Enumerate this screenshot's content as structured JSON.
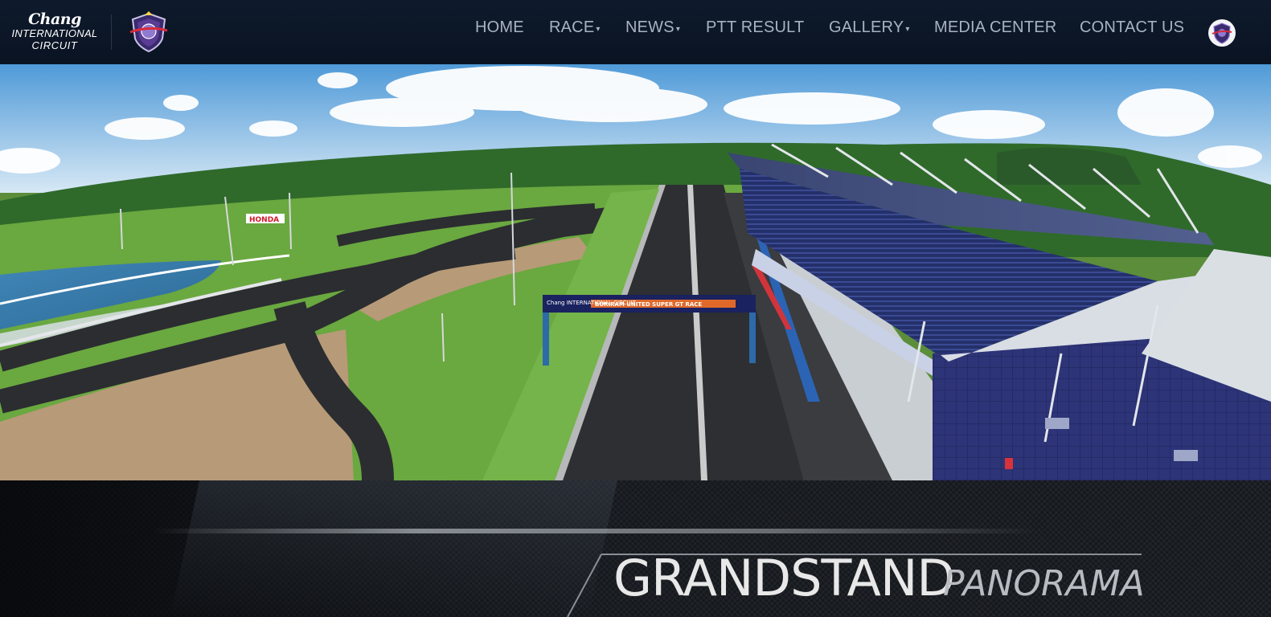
{
  "brand": {
    "line1": "Chang",
    "line2": "INTERNATIONAL",
    "line3": "CIRCUIT"
  },
  "nav": {
    "items": [
      {
        "label": "HOME",
        "dropdown": false
      },
      {
        "label": "RACE",
        "dropdown": true
      },
      {
        "label": "NEWS",
        "dropdown": true
      },
      {
        "label": "PTT RESULT",
        "dropdown": false
      },
      {
        "label": "GALLERY",
        "dropdown": true
      },
      {
        "label": "MEDIA CENTER",
        "dropdown": false
      },
      {
        "label": "CONTACT US",
        "dropdown": false
      }
    ],
    "caret": "▾"
  },
  "hero": {
    "gantry_logo": "Chang INTERNATIONAL CIRCUIT",
    "gantry_banner": "BURIRAM UNITED SUPER GT RACE",
    "sponsor_sign": "HONDA"
  },
  "caption": {
    "title": "GRANDSTAND",
    "subtitle": "PANORAMA"
  },
  "colors": {
    "navbar_bg": "#0c1524",
    "nav_text": "#a9b2c0",
    "caption_title": "#e8e8e8",
    "caption_subtitle": "#b8bcc2",
    "grandstand_blue": "#2d3a78",
    "grass": "#69a83f"
  }
}
